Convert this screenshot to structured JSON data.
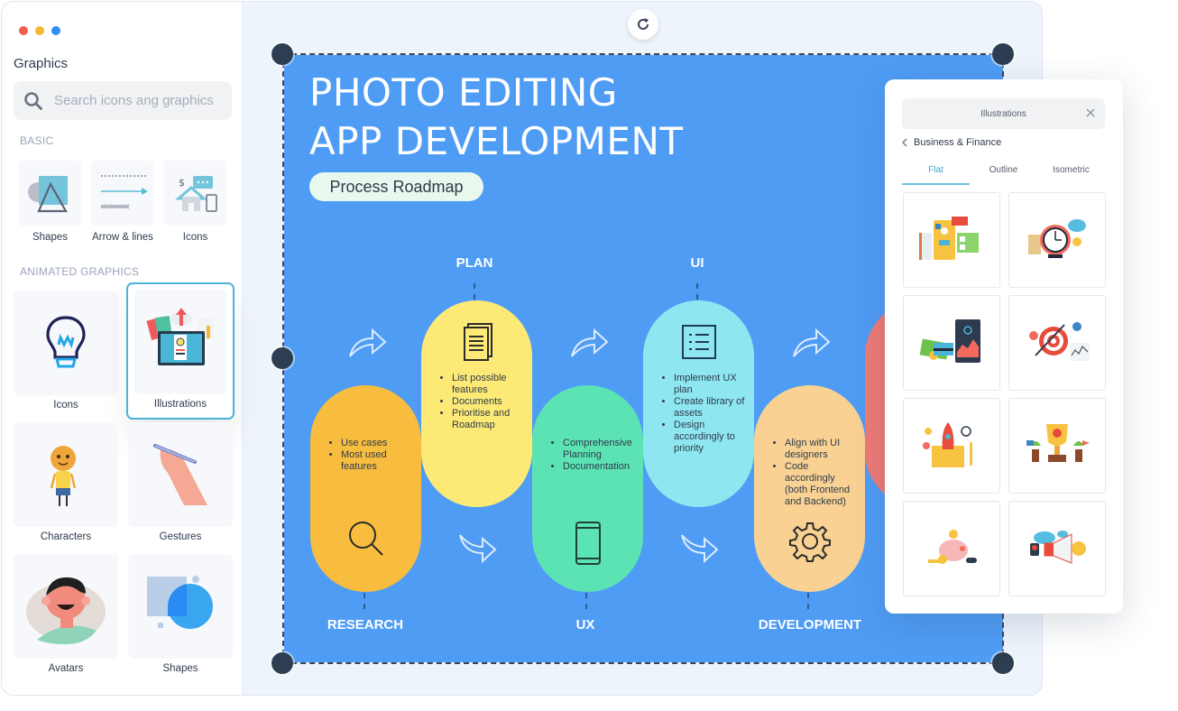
{
  "window": {
    "controls": [
      {
        "name": "close",
        "color": "#f25c4d"
      },
      {
        "name": "minimize",
        "color": "#f7b733"
      },
      {
        "name": "maximize",
        "color": "#2d8ef4"
      }
    ]
  },
  "sidebar": {
    "title": "Graphics",
    "search_placeholder": "Search icons ang graphics",
    "basic_label": "BASIC",
    "basic_items": [
      {
        "label": "Shapes",
        "icon": "shapes-icon"
      },
      {
        "label": "Arrow & lines",
        "icon": "arrows-lines-icon"
      },
      {
        "label": "Icons",
        "icon": "icons-house-icon"
      }
    ],
    "animated_label": "ANIMATED GRAPHICS",
    "animated_items": [
      {
        "label": "Icons",
        "icon": "lightbulb-icon"
      },
      {
        "label": "Illustrations",
        "icon": "tablet-illustration-icon",
        "selected": true
      },
      {
        "label": "Characters",
        "icon": "character-icon"
      },
      {
        "label": "Gestures",
        "icon": "hand-pen-icon"
      },
      {
        "label": "Avatars",
        "icon": "avatar-face-icon"
      },
      {
        "label": "Shapes",
        "icon": "shapes-circle-icon"
      }
    ]
  },
  "canvas": {
    "rotate_icon": "rotate-icon",
    "artboard": {
      "title_line1": "PHOTO EDITING",
      "title_line2": "APP DEVELOPMENT",
      "subtitle": "Process Roadmap",
      "stages": [
        {
          "label": "RESEARCH",
          "color": "#f8bd3e",
          "icon": "magnifier-icon",
          "bullets": [
            "Use cases",
            "Most used features"
          ]
        },
        {
          "label": "PLAN",
          "color": "#fdea76",
          "icon": "documents-icon",
          "bullets": [
            "List possible features",
            "Documents",
            "Prioritise and Roadmap"
          ]
        },
        {
          "label": "UX",
          "color": "#5ce3b4",
          "icon": "smartphone-icon",
          "bullets": [
            "Comprehensive Planning",
            "Documentation"
          ]
        },
        {
          "label": "UI",
          "color": "#8ee6f1",
          "icon": "list-icon",
          "bullets": [
            "Implement UX plan",
            "Create library of assets",
            "Design accordingly to priority"
          ]
        },
        {
          "label": "DEVELOPMENT",
          "color": "#f9d293",
          "icon": "gear-icon",
          "bullets": [
            "Align with UI designers",
            "Code accordingly (both Frontend and Backend)"
          ]
        },
        {
          "label": "",
          "color": "#ee7b78",
          "icon": "",
          "bullets": []
        }
      ]
    }
  },
  "panel": {
    "search_value": "Illustrations",
    "back_label": "Business & Finance",
    "tabs": [
      {
        "label": "Flat",
        "active": true
      },
      {
        "label": "Outline",
        "active": false
      },
      {
        "label": "Isometric",
        "active": false
      }
    ],
    "thumbnails": [
      {
        "name": "recruitment-illustration"
      },
      {
        "name": "clock-coffee-illustration"
      },
      {
        "name": "money-mobile-illustration"
      },
      {
        "name": "target-arrow-illustration"
      },
      {
        "name": "rocket-launch-illustration"
      },
      {
        "name": "trophy-illustration"
      },
      {
        "name": "piggy-bank-illustration"
      },
      {
        "name": "megaphone-illustration"
      }
    ]
  }
}
